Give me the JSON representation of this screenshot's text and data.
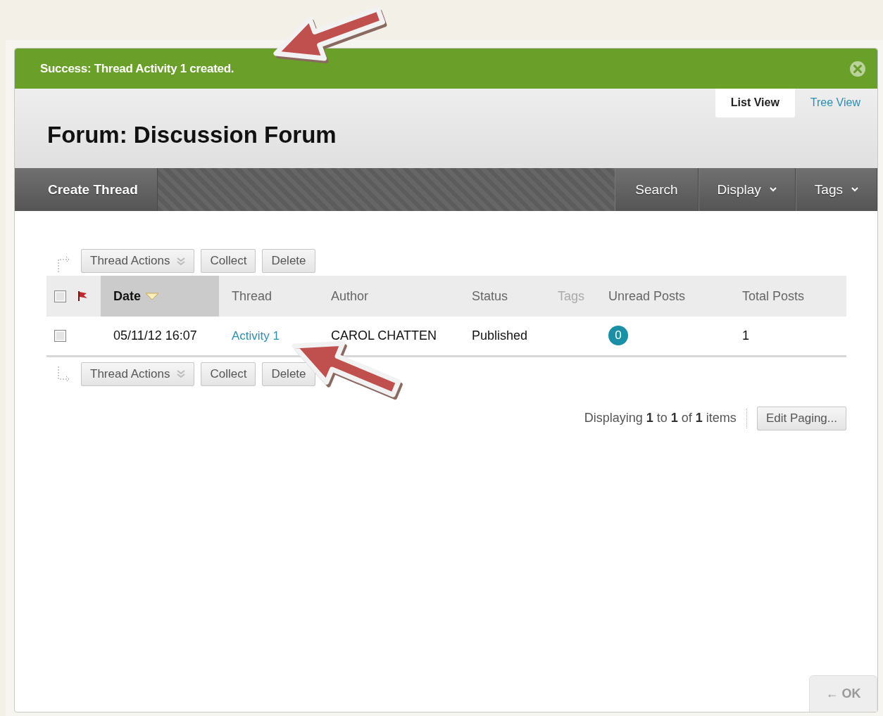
{
  "banner": {
    "message": "Success: Thread Activity 1 created."
  },
  "view_tabs": [
    {
      "label": "List View",
      "selected": true
    },
    {
      "label": "Tree View",
      "selected": false
    }
  ],
  "title": "Forum: Discussion Forum",
  "action_bar": {
    "primary": [
      {
        "label": "Create Thread"
      }
    ],
    "secondary": [
      {
        "label": "Search",
        "kind": "plain"
      },
      {
        "label": "Display",
        "kind": "menu"
      },
      {
        "label": "Tags",
        "kind": "menu"
      }
    ]
  },
  "top_actions": [
    {
      "label": "Thread Actions",
      "kind": "menu"
    },
    {
      "label": "Collect",
      "kind": "plain"
    },
    {
      "label": "Delete",
      "kind": "plain"
    }
  ],
  "table": {
    "select_all": {
      "checked": false
    },
    "columns": [
      {
        "label": "Date",
        "sorted": true,
        "disabled": false
      },
      {
        "label": "Thread",
        "sorted": false,
        "disabled": false
      },
      {
        "label": "Author",
        "sorted": false,
        "disabled": false
      },
      {
        "label": "Status",
        "sorted": false,
        "disabled": false
      },
      {
        "label": "Tags",
        "sorted": false,
        "disabled": true
      },
      {
        "label": "Unread Posts",
        "sorted": false,
        "disabled": false
      },
      {
        "label": "Total Posts",
        "sorted": false,
        "disabled": false
      }
    ],
    "rows": [
      {
        "checked": false,
        "date": "05/11/12 16:07",
        "thread": "Activity 1",
        "author": "CAROL CHATTEN",
        "status": "Published",
        "unread": "0",
        "total": "1"
      }
    ]
  },
  "bottom_actions": [
    {
      "label": "Thread Actions",
      "kind": "menu"
    },
    {
      "label": "Collect",
      "kind": "plain"
    },
    {
      "label": "Delete",
      "kind": "plain"
    }
  ],
  "paging": {
    "text": "Displaying **1** to **1** of **1** items",
    "button": "Edit Paging..."
  },
  "ok_button": "← OK"
}
